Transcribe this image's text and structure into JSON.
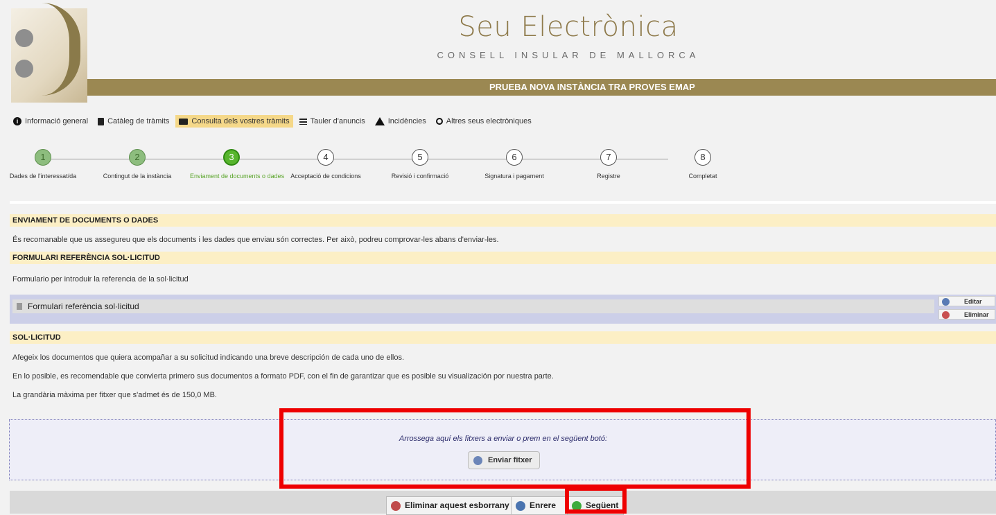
{
  "header": {
    "site_title": "Seu Electrònica",
    "site_subtitle": "CONSELL INSULAR DE MALLORCA",
    "procedure_title": "PRUEBA NOVA INSTÀNCIA TRA PROVES EMAP"
  },
  "nav": {
    "items": [
      {
        "label": "Informació general",
        "icon": "info-icon"
      },
      {
        "label": "Catàleg de tràmits",
        "icon": "document-icon"
      },
      {
        "label": "Consulta dels vostres tràmits",
        "icon": "folder-icon",
        "active": true
      },
      {
        "label": "Tauler d'anuncis",
        "icon": "board-icon"
      },
      {
        "label": "Incidències",
        "icon": "warning-icon"
      },
      {
        "label": "Altres seus electròniques",
        "icon": "globe-icon"
      }
    ]
  },
  "steps": [
    {
      "num": "1",
      "label": "Dades de l'interessat/da",
      "state": "done"
    },
    {
      "num": "2",
      "label": "Contingut de la instància",
      "state": "done"
    },
    {
      "num": "3",
      "label": "Enviament de documents o dades",
      "state": "current"
    },
    {
      "num": "4",
      "label": "Acceptació de condicions",
      "state": "pending"
    },
    {
      "num": "5",
      "label": "Revisió i confirmació",
      "state": "pending"
    },
    {
      "num": "6",
      "label": "Signatura i pagament",
      "state": "pending"
    },
    {
      "num": "7",
      "label": "Registre",
      "state": "pending"
    },
    {
      "num": "8",
      "label": "Completat",
      "state": "pending"
    }
  ],
  "main": {
    "section1_title": "ENVIAMENT DE DOCUMENTS O DADES",
    "section1_text": "És recomanable que us assegureu que els documents i les dades que enviau són correctes. Per això, podreu comprovar-les abans d'enviar-les.",
    "section2_title": "FORMULARI REFERÈNCIA SOL·LICITUD",
    "section2_text": "Formulario per introduir la referencia de la sol·licitud",
    "form_item_label": "Formulari referència sol·licitud",
    "edit_label": "Editar",
    "delete_label": "Eliminar",
    "section3_title": "SOL·LICITUD",
    "section3_text1": "Afegeix los documentos que quiera acompañar a su solicitud indicando una breve descripción de cada uno de ellos.",
    "section3_text2": "En lo posible, es recomendable que convierta primero sus documentos a formato PDF, con el fin de garantizar que es posible su visualización por nuestra parte.",
    "section3_text3": "La grandària màxima per fitxer que s'admet és de 150,0 MB."
  },
  "dropzone": {
    "hint": "Arrossega aquí els fitxers a enviar o prem en el següent botó:",
    "send_label": "Enviar fitxer"
  },
  "footer": {
    "delete_draft_label": "Eliminar aquest esborrany",
    "back_label": "Enrere",
    "next_label": "Següent"
  },
  "colors": {
    "accent_gold": "#9b8852",
    "highlight_red": "#ee0000",
    "step_current_green": "#57b52d"
  }
}
